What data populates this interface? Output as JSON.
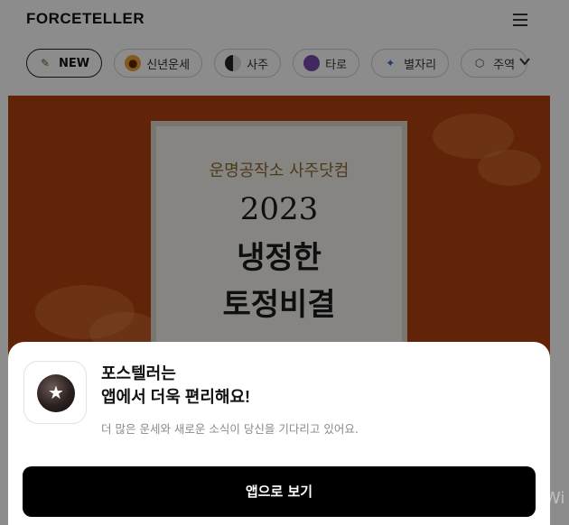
{
  "header": {
    "logo_text": "FORCETELLER",
    "menu_icon": "hamburger-menu-icon"
  },
  "categories": [
    {
      "label": "NEW",
      "icon": "new-pencil-icon",
      "active": true
    },
    {
      "label": "신년운세",
      "icon": "tiger-icon",
      "active": false
    },
    {
      "label": "사주",
      "icon": "yin-yang-icon",
      "active": false
    },
    {
      "label": "타로",
      "icon": "crystal-ball-icon",
      "active": false
    },
    {
      "label": "별자리",
      "icon": "shooting-star-icon",
      "active": false
    },
    {
      "label": "주역",
      "icon": "hexagon-icon",
      "active": false
    }
  ],
  "banner": {
    "subtitle": "운명공작소 사주닷컴",
    "year": "2023",
    "title_line1": "냉정한",
    "title_line2": "토정비결"
  },
  "app_prompt": {
    "title_line1": "포스텔러는",
    "title_line2": "앱에서 더욱 편리해요!",
    "description": "더 많은 운세와 새로운 소식이 당신을 기다리고 있어요.",
    "button_label": "앱으로 보기"
  },
  "watermark_text": "Wi",
  "colors": {
    "banner_bg": "#b3420f",
    "button_bg": "#000000"
  }
}
